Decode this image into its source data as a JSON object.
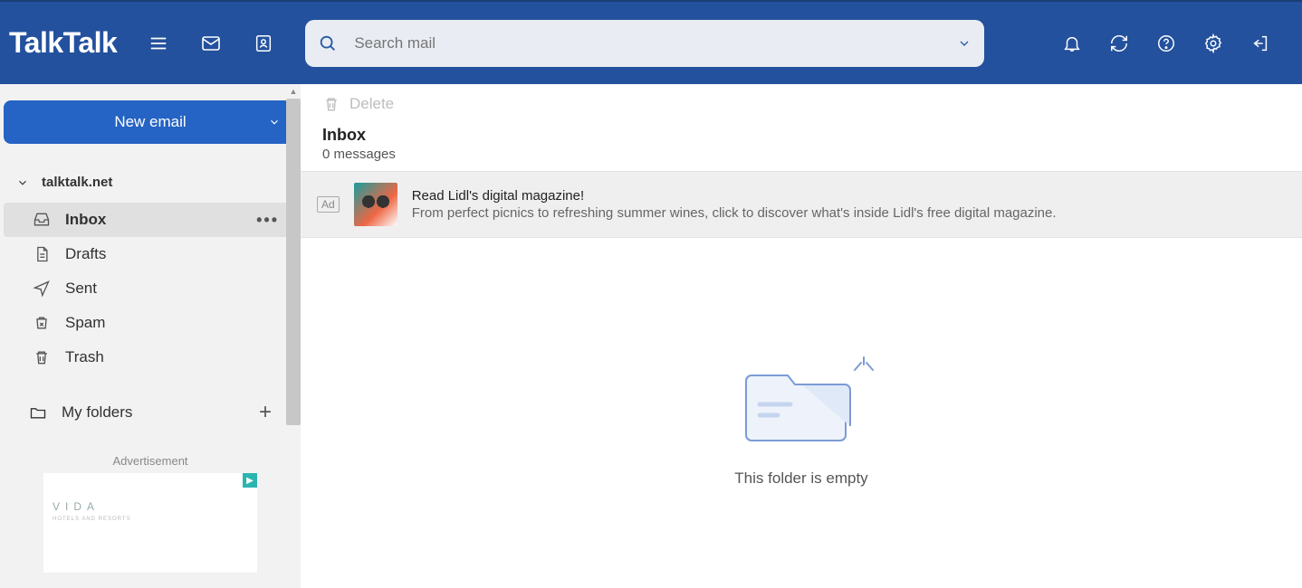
{
  "brand": "TalkTalk",
  "search": {
    "placeholder": "Search mail"
  },
  "compose_label": "New email",
  "account_label": "talktalk.net",
  "folders": {
    "inbox": "Inbox",
    "drafts": "Drafts",
    "sent": "Sent",
    "spam": "Spam",
    "trash": "Trash",
    "myfolders": "My folders"
  },
  "sidebar_ad": {
    "label": "Advertisement",
    "brand": "VIDA",
    "tagline": "HOTELS AND RESORTS"
  },
  "toolbar": {
    "delete": "Delete"
  },
  "list": {
    "title": "Inbox",
    "count": "0 messages",
    "empty_msg": "This folder is empty"
  },
  "inline_ad": {
    "badge": "Ad",
    "title": "Read Lidl's digital magazine!",
    "desc": "From perfect picnics to refreshing summer wines, click to discover what's inside Lidl's free digital magazine."
  }
}
